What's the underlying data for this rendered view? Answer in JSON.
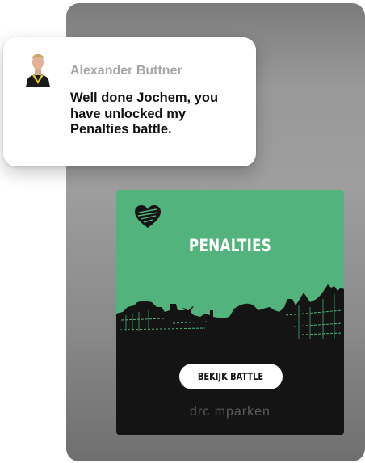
{
  "notification": {
    "sender": "Alexander Buttner",
    "message": "Well done Jochem, you have unlocked my Penalties battle."
  },
  "card": {
    "title": "PENALTIES",
    "button_label": "BEKIJK BATTLE",
    "brand": "drc  mparken"
  },
  "colors": {
    "card_green": "#52b37c",
    "skyline_dark": "#141414",
    "sender_gray": "#a6a6a6"
  },
  "icons": [
    "heart-icon",
    "bird-icon",
    "player-avatar"
  ]
}
